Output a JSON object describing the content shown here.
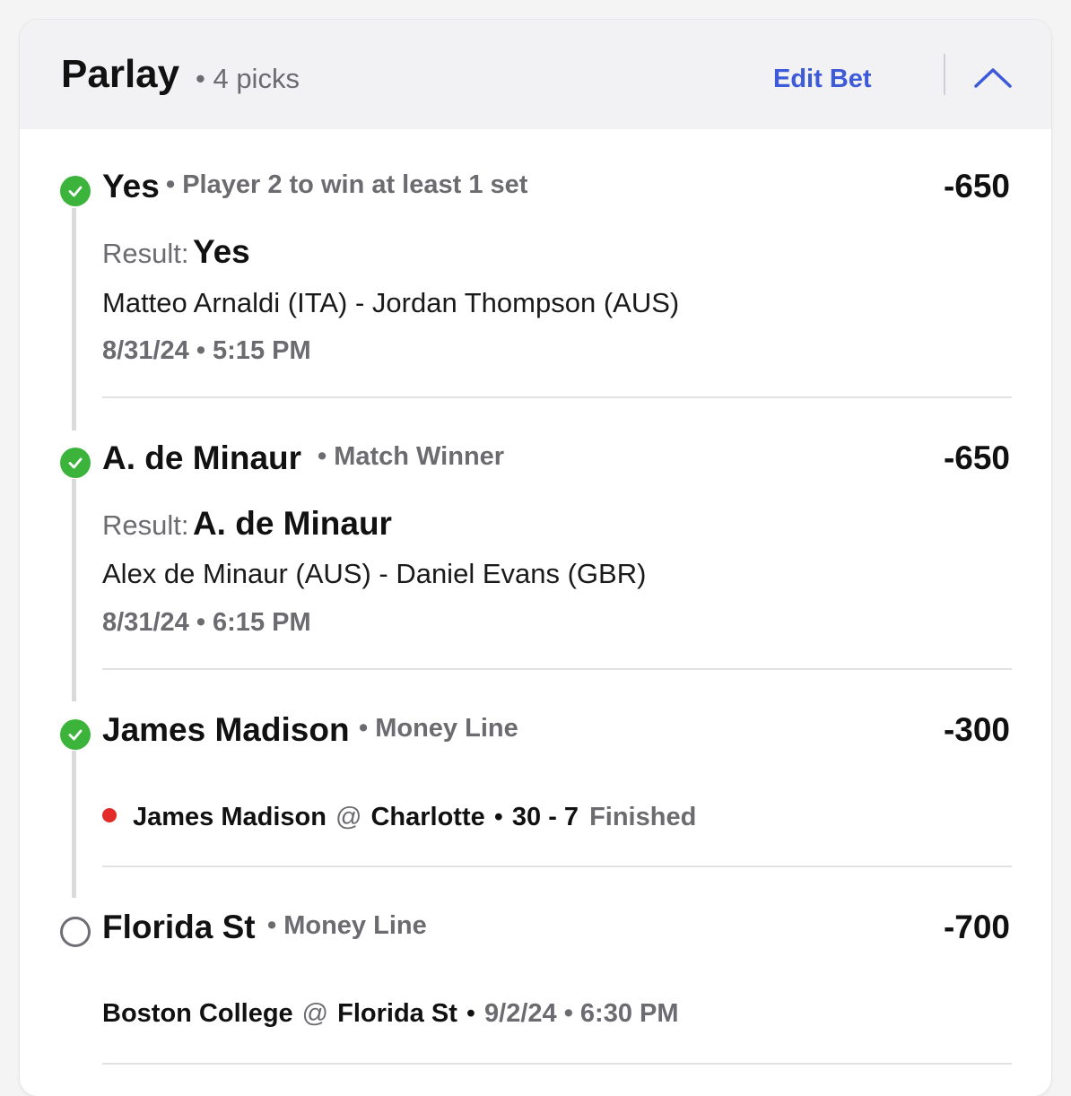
{
  "header": {
    "title": "Parlay",
    "subtitle": "• 4 picks",
    "edit_label": "Edit Bet",
    "collapse_icon": "chevron-up-icon"
  },
  "colors": {
    "accent": "#3d5bd9",
    "won": "#3cb43c",
    "live": "#e32b2b",
    "muted": "#6b6b70"
  },
  "picks": [
    {
      "status": "won",
      "selection": "Yes",
      "market": "• Player 2 to win at least 1 set",
      "odds": "-650",
      "result_label": "Result:",
      "result_value": "Yes",
      "matchup": "Matteo Arnaldi (ITA) - Jordan Thompson (AUS)",
      "datetime": "8/31/24 • 5:15 PM"
    },
    {
      "status": "won",
      "selection": "A. de Minaur",
      "market": "• Match Winner",
      "odds": "-650",
      "result_label": "Result:",
      "result_value": "A. de Minaur",
      "matchup": "Alex de Minaur (AUS) - Daniel Evans (GBR)",
      "datetime": "8/31/24 • 6:15 PM"
    },
    {
      "status": "won",
      "selection": "James Madison",
      "market": "• Money Line",
      "odds": "-300",
      "away_team": "James Madison",
      "at": "@",
      "home_team": "Charlotte",
      "sep": "•",
      "score": "30 - 7",
      "game_status": "Finished"
    },
    {
      "status": "pending",
      "selection": "Florida St",
      "market": "• Money Line",
      "odds": "-700",
      "away_team": "Boston College",
      "at": "@",
      "home_team": "Florida St",
      "sep": "•",
      "datetime": "9/2/24 • 6:30 PM"
    }
  ]
}
